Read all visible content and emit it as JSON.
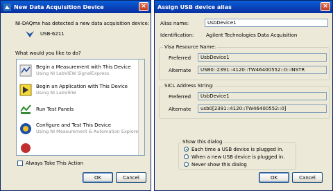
{
  "left_window": {
    "title": "New Data Acquisition Device",
    "detected_text": "NI-DAQmx has detected a new data acquisition device:",
    "device_name": "USB-6211",
    "question": "What would you like to do?",
    "actions": [
      {
        "title": "Begin a Measurement with This Device",
        "subtitle": "Using NI LabVIEW SignalExpress"
      },
      {
        "title": "Begin an Application with This Device",
        "subtitle": "Using NI LabVIEW"
      },
      {
        "title": "Run Test Panels",
        "subtitle": ""
      },
      {
        "title": "Configure and Test This Device",
        "subtitle": "Using NI Measurement & Automation Explorer"
      }
    ],
    "always_label": "Always Take This Action",
    "ok_label": "OK",
    "cancel_label": "Cancel"
  },
  "right_window": {
    "title": "Assign USB device alias",
    "alias_label": "Alias name:",
    "alias_value": "UsbDevice1",
    "identification_label": "Identification:",
    "identification_value": "Agilent Technologies Data Acquisition",
    "visa_group_title": "Visa Resource Name:",
    "visa_preferred_label": "Preferred",
    "visa_preferred_value": "UsbDevice1",
    "visa_alternate_label": "Alternate",
    "visa_alternate_value": "USB0::2391::4120::TW46400552::0::INSTR",
    "sicl_group_title": "SICL Address String:",
    "sicl_preferred_label": "Preferred",
    "sicl_preferred_value": "UsbDevice1",
    "sicl_alternate_label": "Alternate",
    "sicl_alternate_value": "usb0[2391::4120::TW46400552::0]",
    "show_group_title": "Show this dialog",
    "show_options": [
      "Each time a USB device is plugged in.",
      "When a new USB device is plugged in.",
      "Never show this dialog"
    ],
    "selected_option": 0,
    "ok_label": "OK",
    "cancel_label": "Cancel"
  }
}
